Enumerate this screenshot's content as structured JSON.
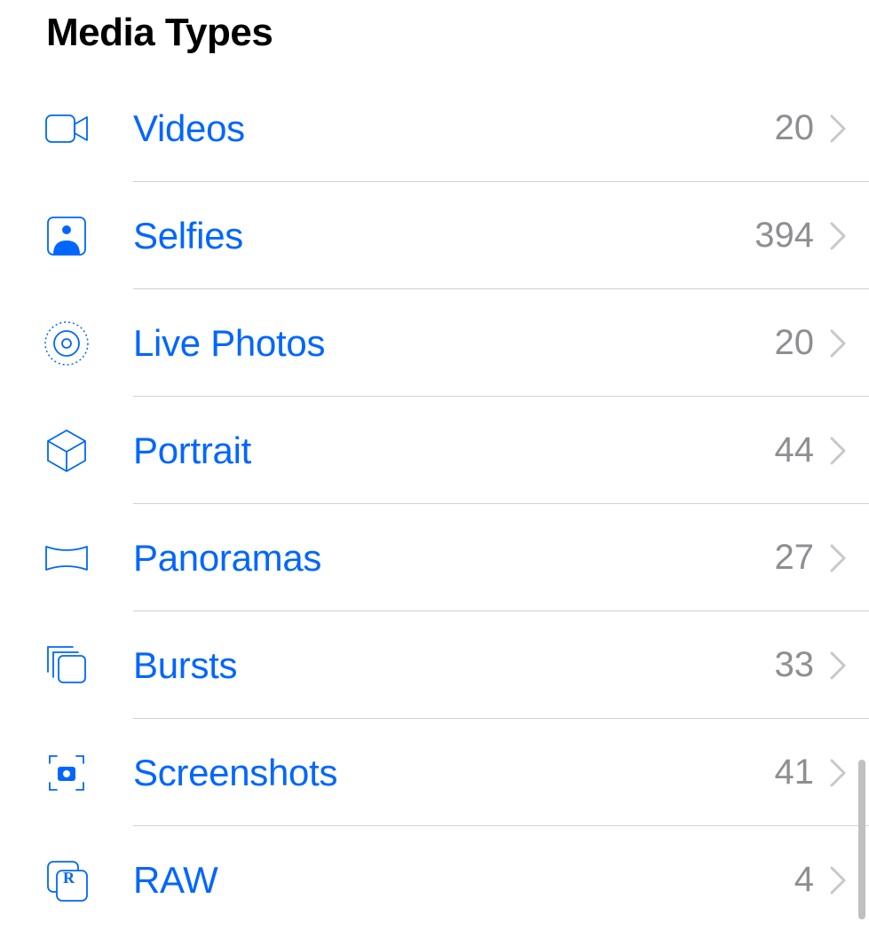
{
  "section": {
    "title": "Media Types"
  },
  "items": [
    {
      "icon": "video-icon",
      "label": "Videos",
      "count": "20"
    },
    {
      "icon": "selfies-icon",
      "label": "Selfies",
      "count": "394"
    },
    {
      "icon": "live-photos-icon",
      "label": "Live Photos",
      "count": "20"
    },
    {
      "icon": "portrait-icon",
      "label": "Portrait",
      "count": "44"
    },
    {
      "icon": "panoramas-icon",
      "label": "Panoramas",
      "count": "27"
    },
    {
      "icon": "bursts-icon",
      "label": "Bursts",
      "count": "33"
    },
    {
      "icon": "screenshots-icon",
      "label": "Screenshots",
      "count": "41"
    },
    {
      "icon": "raw-icon",
      "label": "RAW",
      "count": "4"
    }
  ]
}
